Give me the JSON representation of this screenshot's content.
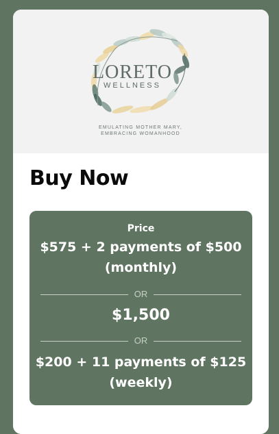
{
  "brand": {
    "name": "LORETO",
    "subname": "WELLNESS",
    "tagline_line1": "EMULATING MOTHER MARY,",
    "tagline_line2": "EMBRACING WOMANHOOD"
  },
  "heading": "Buy Now",
  "pricing": {
    "label": "Price",
    "or_text": "OR",
    "options": [
      {
        "line1": "$575 + 2 payments of $500",
        "line2": "(monthly)"
      },
      {
        "line1": "$1,500"
      },
      {
        "line1": "$200 + 11 payments of $125",
        "line2": "(weekly)"
      }
    ]
  },
  "colors": {
    "background": "#5f7561",
    "card": "#ffffff",
    "hero": "#f2f2f2",
    "price_box": "#5f7561",
    "heading": "#0b0b0b"
  }
}
